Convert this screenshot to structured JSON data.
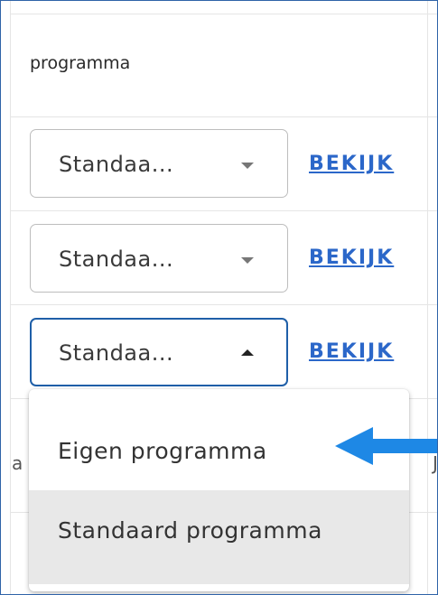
{
  "table": {
    "column_header": "programma",
    "rows": [
      {
        "select_value": "Standaa...",
        "link_label": "BEKIJK"
      },
      {
        "select_value": "Standaa...",
        "link_label": "BEKIJK"
      },
      {
        "select_value": "Standaa...",
        "link_label": "BEKIJK"
      }
    ],
    "clipped_left": "a",
    "clipped_right": "J"
  },
  "dropdown": {
    "options": [
      {
        "label": "Eigen programma"
      },
      {
        "label": "Standaard programma"
      }
    ],
    "selected_index": 1
  },
  "annotation": {
    "arrow_color": "#1e88e5",
    "points_to": "Eigen programma"
  },
  "colors": {
    "link": "#2b67c9",
    "focus_border": "#1f5fa8",
    "frame_border": "#2f63a8"
  }
}
